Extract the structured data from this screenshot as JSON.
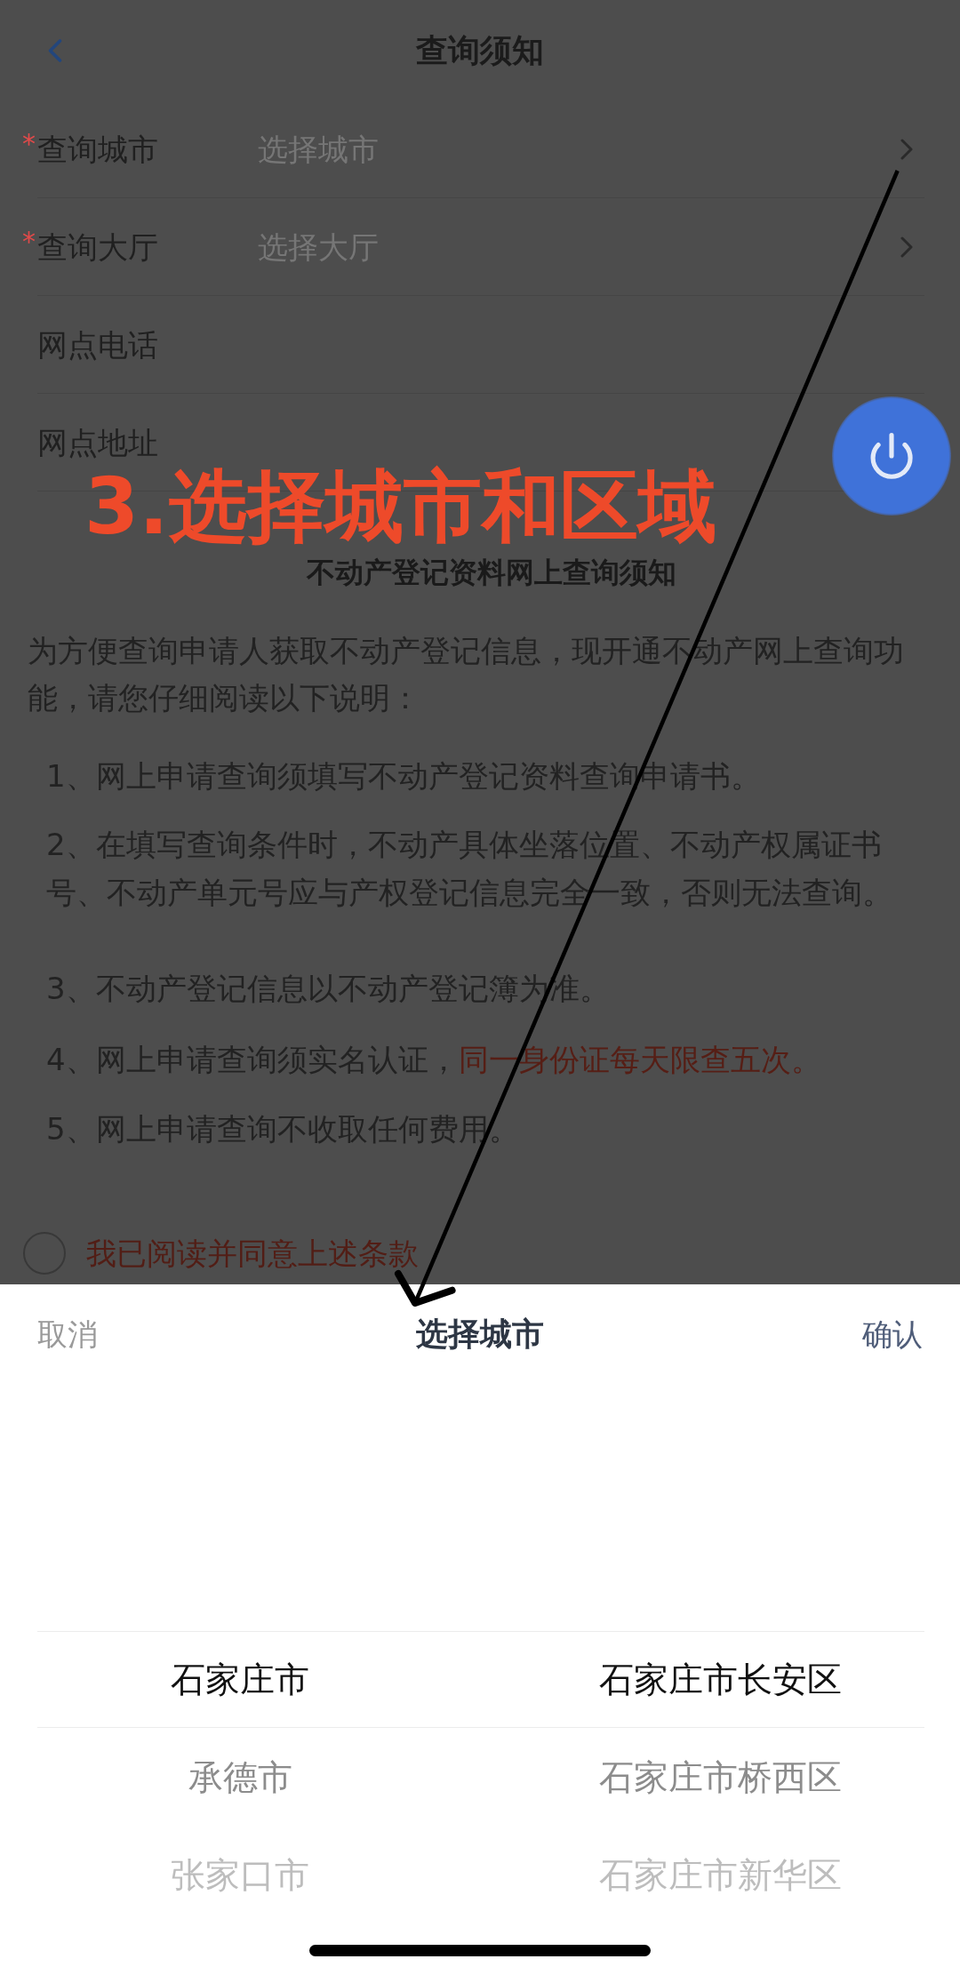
{
  "nav": {
    "title": "查询须知"
  },
  "form": {
    "rows": [
      {
        "kind": "select",
        "required_mark": "*",
        "label": "查询城市",
        "placeholder": "选择城市"
      },
      {
        "kind": "select",
        "required_mark": "*",
        "label": "查询大厅",
        "placeholder": "选择大厅"
      },
      {
        "kind": "text",
        "label": "网点电话"
      },
      {
        "kind": "text",
        "label": "网点地址"
      }
    ]
  },
  "annotation": {
    "text": "3.选择城市和区域"
  },
  "notice": {
    "title": "不动产登记资料网上查询须知",
    "intro": "为方便查询申请人获取不动产登记信息，现开通不动产网上查询功能，请您仔细阅读以下说明：",
    "items": [
      {
        "text": "1、网上申请查询须填写不动产登记资料查询申请书。"
      },
      {
        "text": "2、在填写查询条件时，不动产具体坐落位置、不动产权属证书号、不动产单元号应与产权登记信息完全一致，否则无法查询。"
      },
      {
        "text": "3、不动产登记信息以不动产登记簿为准。"
      },
      {
        "text": "4、网上申请查询须实名认证，",
        "warning": "同一身份证每天限查五次。"
      },
      {
        "text": "5、网上申请查询不收取任何费用。"
      }
    ]
  },
  "agreement": {
    "checked": false,
    "label": "我已阅读并同意上述条款"
  },
  "picker": {
    "cancel": "取消",
    "title": "选择城市",
    "confirm": "确认",
    "columns": [
      {
        "options": [
          {
            "label": "石家庄市",
            "selected": true
          },
          {
            "label": "承德市",
            "selected": false
          },
          {
            "label": "张家口市",
            "selected": false
          }
        ]
      },
      {
        "options": [
          {
            "label": "石家庄市长安区",
            "selected": true
          },
          {
            "label": "石家庄市桥西区",
            "selected": false
          },
          {
            "label": "石家庄市新华区",
            "selected": false
          }
        ]
      }
    ]
  }
}
